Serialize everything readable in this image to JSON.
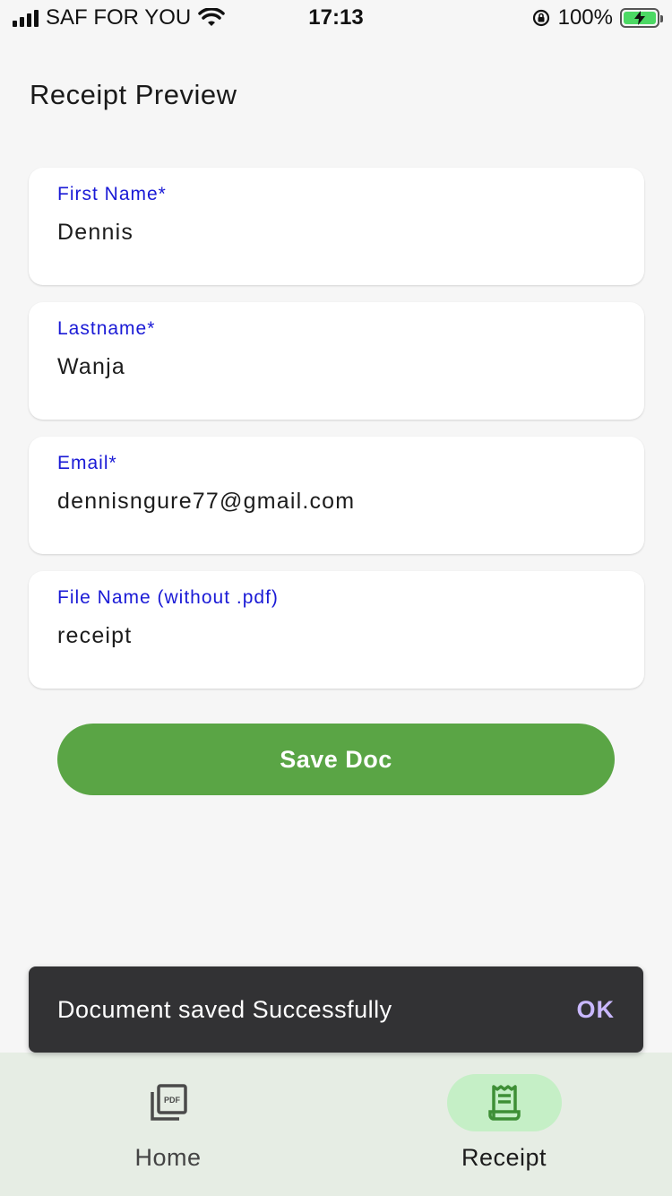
{
  "status_bar": {
    "carrier": "SAF FOR YOU",
    "time": "17:13",
    "battery": "100%",
    "battery_level": 1.0
  },
  "page": {
    "title": "Receipt Preview"
  },
  "form": {
    "fields": [
      {
        "label": "First Name*",
        "value": "Dennis"
      },
      {
        "label": "Lastname*",
        "value": "Wanja"
      },
      {
        "label": "Email*",
        "value": "dennisngure77@gmail.com"
      },
      {
        "label": "File Name (without .pdf)",
        "value": "receipt"
      }
    ],
    "save_label": "Save Doc"
  },
  "snackbar": {
    "message": "Document saved Successfully",
    "action": "OK"
  },
  "bottom_nav": {
    "items": [
      {
        "label": "Home",
        "icon": "pdf-file-icon",
        "active": false
      },
      {
        "label": "Receipt",
        "icon": "receipt-icon",
        "active": true
      }
    ]
  },
  "colors": {
    "accent_green": "#5aa545",
    "label_blue": "#1a1ad6",
    "nav_active_bg": "#c5efc6",
    "snackbar_action": "#c9b8ff"
  }
}
